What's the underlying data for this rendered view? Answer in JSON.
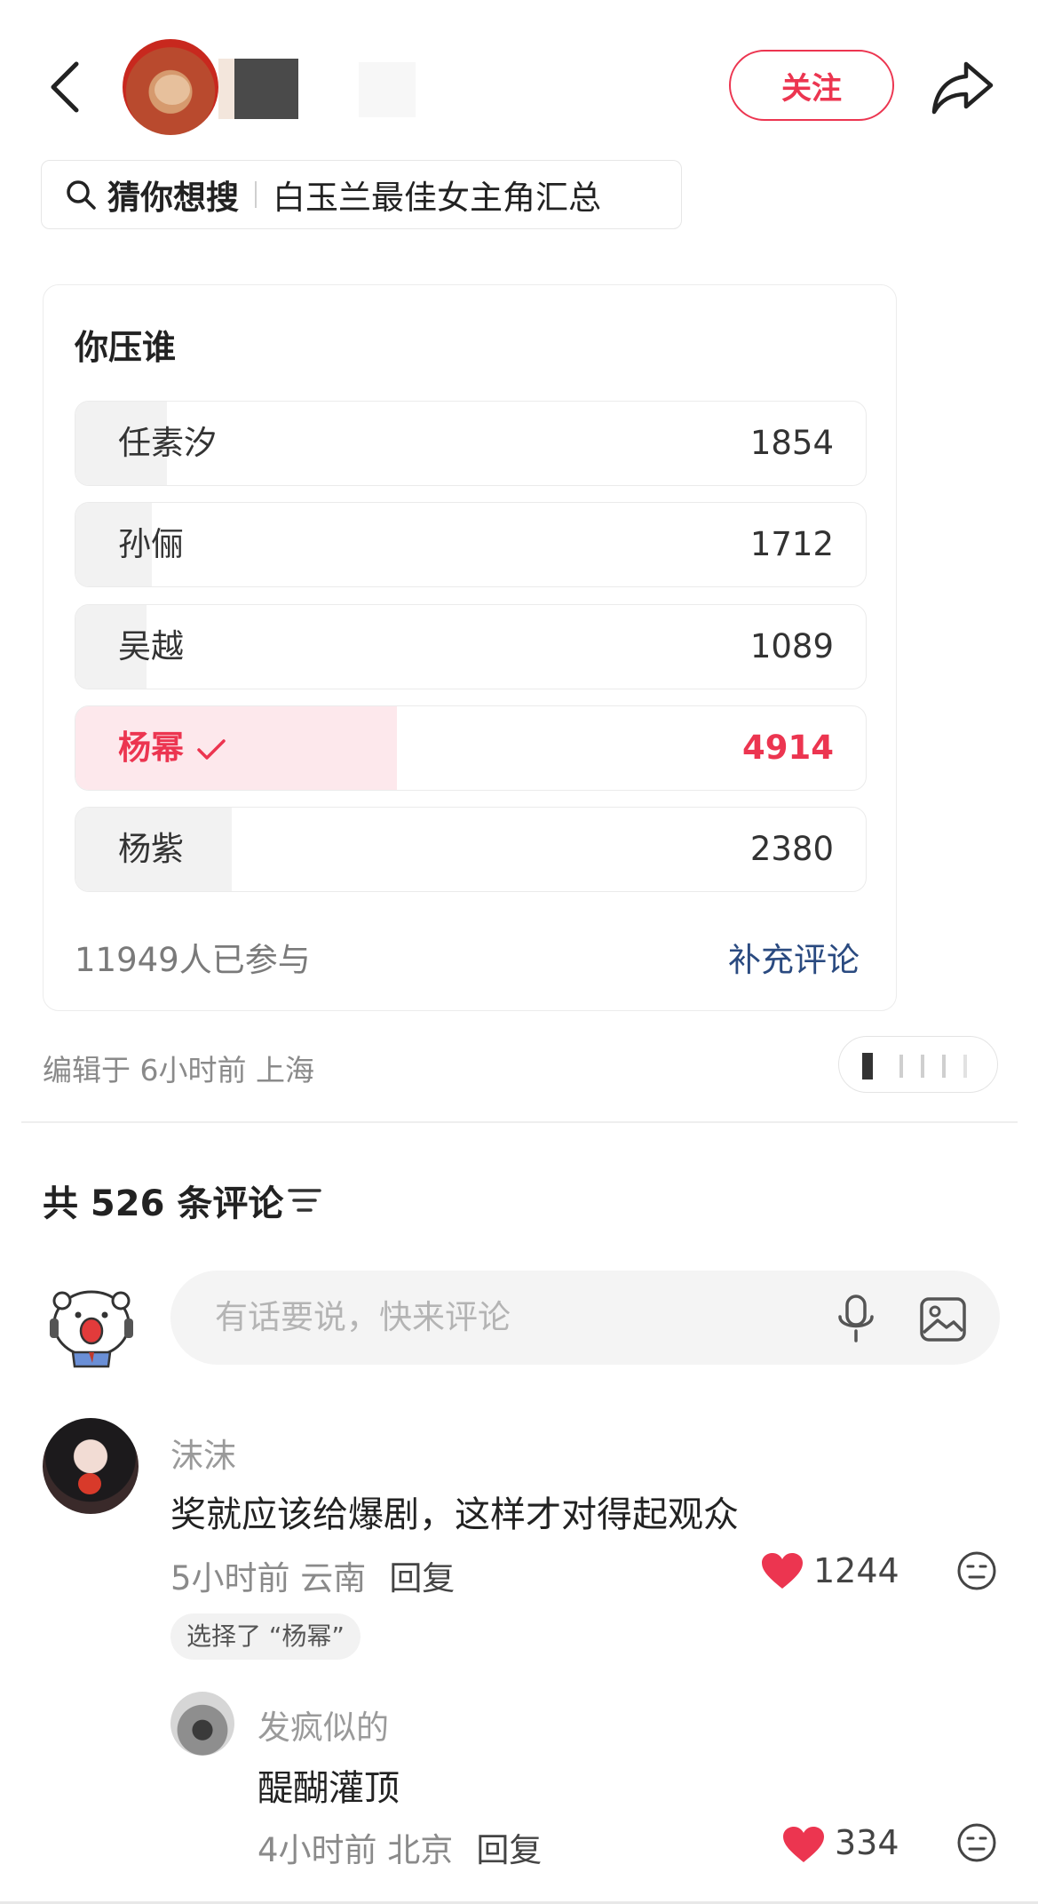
{
  "header": {
    "follow_label": "关注",
    "accent_color": "#ec3550"
  },
  "guess": {
    "lead": "猜你想搜",
    "query": "白玉兰最佳女主角汇总"
  },
  "poll": {
    "title": "你压谁",
    "options": [
      {
        "name": "任素汐",
        "count": "1854",
        "selected": false,
        "share": 0.155
      },
      {
        "name": "孙俪",
        "count": "1712",
        "selected": false,
        "share": 0.143
      },
      {
        "name": "吴越",
        "count": "1089",
        "selected": false,
        "share": 0.091
      },
      {
        "name": "杨幂",
        "count": "4914",
        "selected": true,
        "share": 0.411
      },
      {
        "name": "杨紫",
        "count": "2380",
        "selected": false,
        "share": 0.199
      }
    ],
    "participants": "11949人已参与",
    "add_comment": "补充评论"
  },
  "meta": {
    "edited": "编辑于 6小时前 上海"
  },
  "comments": {
    "title": "共 526 条评论",
    "input_placeholder": "有话要说，快来评论",
    "items": [
      {
        "user": "沫沫",
        "text": "奖就应该给爆剧，这样才对得起观众",
        "time_loc": "5小时前 云南",
        "reply": "回复",
        "likes": "1244",
        "chose": "选择了 “杨幂”"
      },
      {
        "user": "发疯似的",
        "text": "醍醐灌顶",
        "time_loc": "4小时前 北京",
        "reply": "回复",
        "likes": "334"
      }
    ]
  }
}
